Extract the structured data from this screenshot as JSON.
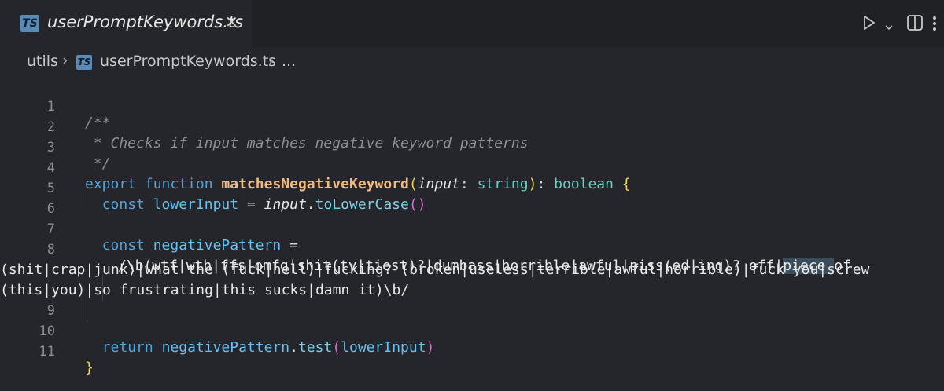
{
  "tab": {
    "badge": "TS",
    "title": "userPromptKeywords.ts",
    "close": "✕"
  },
  "breadcrumb": {
    "folder": "utils",
    "badge": "TS",
    "file": "userPromptKeywords.ts",
    "more": "..."
  },
  "icons": [
    "play-icon",
    "chevron-down-icon",
    "split-editor-icon",
    "more-icon"
  ],
  "editor": {
    "line_numbers": [
      "1",
      "2",
      "3",
      "4",
      "5",
      "6",
      "7",
      "8",
      "9",
      "10",
      "11"
    ],
    "line1": "/**",
    "line2": " * Checks if input matches negative keyword patterns",
    "line3": " */",
    "line4": {
      "export": "export",
      "function": "function",
      "name": "matchesNegativeKeyword",
      "param": "input",
      "type": "string",
      "ret": "boolean"
    },
    "line5": {
      "const": "const",
      "var": "lowerInput",
      "obj": "input",
      "method": "toLowerCase"
    },
    "line7": {
      "const": "const",
      "var": "negativePattern"
    },
    "line8": {
      "part1": "/\\b(wtf|wth|ffs|omfg|shit(ty|tiest)?|dumbass|horrible|awful|piss(ed|ing)? off|",
      "highlight": "piece ",
      "part2": "of",
      "wrap1": "(shit|crap|junk)|what the (fuck|hell)|fucking? (broken|useless|terrible|awful|horrible)|fuck you|screw",
      "wrap2": "(this|you)|so frustrating|this sucks|damn it)\\b/"
    },
    "line10": {
      "return": "return",
      "var": "negativePattern",
      "method": "test",
      "arg": "lowerInput"
    },
    "line11": "}"
  }
}
